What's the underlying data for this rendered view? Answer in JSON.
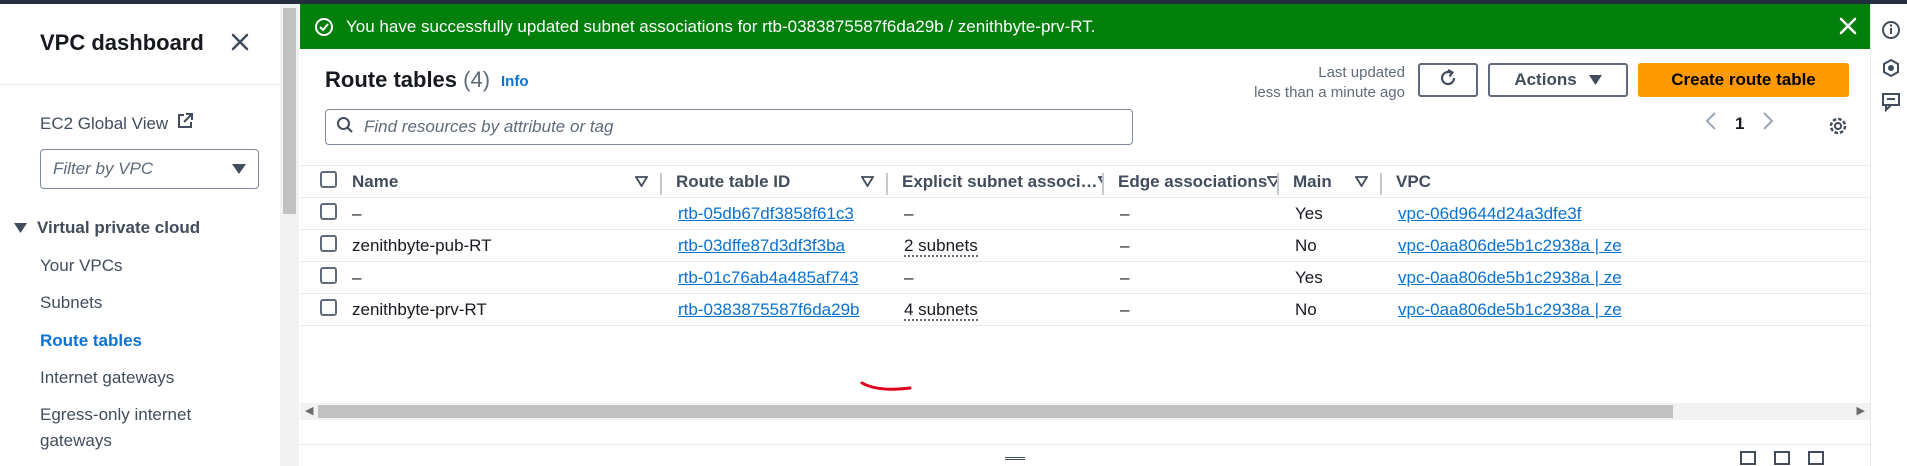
{
  "sidebar": {
    "title": "VPC dashboard",
    "ec2_global_view": "EC2 Global View",
    "filter_placeholder": "Filter by VPC",
    "section": "Virtual private cloud",
    "items": [
      {
        "label": "Your VPCs"
      },
      {
        "label": "Subnets"
      },
      {
        "label": "Route tables",
        "active": true
      },
      {
        "label": "Internet gateways"
      },
      {
        "label": "Egress-only internet gateways"
      }
    ]
  },
  "flash": {
    "message": "You have successfully updated subnet associations for rtb-0383875587f6da29b / zenithbyte-prv-RT."
  },
  "panel": {
    "title": "Route tables",
    "count": "(4)",
    "info": "Info",
    "last_updated_label": "Last updated",
    "last_updated_value": "less than a minute ago",
    "actions_label": "Actions",
    "create_label": "Create route table",
    "search_placeholder": "Find resources by attribute or tag",
    "page": "1"
  },
  "table": {
    "headers": [
      "Name",
      "Route table ID",
      "Explicit subnet associ…",
      "Edge associations",
      "Main",
      "VPC"
    ],
    "rows": [
      {
        "name": "–",
        "id": "rtb-05db67df3858f61c3",
        "explicit": "–",
        "edge": "–",
        "main": "Yes",
        "vpc": "vpc-06d9644d24a3dfe3f"
      },
      {
        "name": "zenithbyte-pub-RT",
        "id": "rtb-03dffe87d3df3f3ba",
        "explicit": "2 subnets",
        "edge": "–",
        "main": "No",
        "vpc": "vpc-0aa806de5b1c2938a | ze"
      },
      {
        "name": "–",
        "id": "rtb-01c76ab4a485af743",
        "explicit": "–",
        "edge": "–",
        "main": "Yes",
        "vpc": "vpc-0aa806de5b1c2938a | ze"
      },
      {
        "name": "zenithbyte-prv-RT",
        "id": "rtb-0383875587f6da29b",
        "explicit": "4 subnets",
        "edge": "–",
        "main": "No",
        "vpc": "vpc-0aa806de5b1c2938a | ze"
      }
    ]
  },
  "colors": {
    "success": "#037f0c",
    "primary_button": "#ff9900",
    "link": "#0972d3",
    "annotation": "#e0001b"
  },
  "icons": [
    "close-icon",
    "external-link-icon",
    "caret-down-icon",
    "success-icon",
    "refresh-icon",
    "search-icon",
    "chevron-left-icon",
    "chevron-right-icon",
    "gear-icon",
    "sort-icon",
    "info-icon",
    "shapes-icon",
    "feedback-icon"
  ]
}
